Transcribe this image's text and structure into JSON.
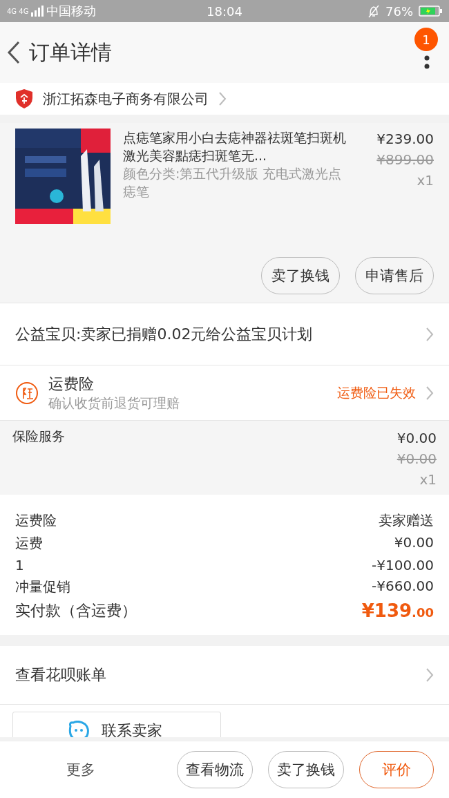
{
  "status_bar": {
    "network": "4G 4G",
    "carrier": "中国移动",
    "time": "18:04",
    "battery": "76%"
  },
  "header": {
    "title": "订单详情",
    "badge": "1"
  },
  "shop": {
    "name": "浙江拓森电子商务有限公司"
  },
  "product": {
    "image": {
      "kind": "picture"
    },
    "title": "点痣笔家用小白去痣神器祛斑笔扫斑机激光美容點痣扫斑笔无...",
    "sku": "颜色分类:第五代升级版 充电式激光点痣笔",
    "price": "¥239.00",
    "original_price": "¥899.00",
    "quantity": "x1",
    "actions": [
      "卖了换钱",
      "申请售后"
    ]
  },
  "charity": {
    "text": "公益宝贝:卖家已捐赠0.02元给公益宝贝计划"
  },
  "shipping_insurance": {
    "title": "运费险",
    "subtitle": "确认收货前退货可理赔",
    "status": "运费险已失效"
  },
  "insurance_service": {
    "name": "保险服务",
    "price": "¥0.00",
    "original_price": "¥0.00",
    "quantity": "x1"
  },
  "summary": [
    {
      "label": "运费险",
      "value": "卖家赠送",
      "kind": "plain"
    },
    {
      "label": "运费",
      "value": "¥0.00",
      "kind": "plain"
    },
    {
      "label": "1",
      "value": "-¥100.00",
      "kind": "plain"
    },
    {
      "label": "冲量促销",
      "value": "-¥660.00",
      "kind": "plain"
    },
    {
      "label": "实付款（含运费）",
      "value": "¥139",
      "cents": ".00",
      "kind": "total"
    }
  ],
  "huabei": {
    "text": "查看花呗账单"
  },
  "contact": {
    "label": "联系卖家"
  },
  "bottom_bar": {
    "more": "更多",
    "buttons": [
      {
        "label": "查看物流",
        "primary": false
      },
      {
        "label": "卖了换钱",
        "primary": false
      },
      {
        "label": "评价",
        "primary": true
      }
    ]
  }
}
